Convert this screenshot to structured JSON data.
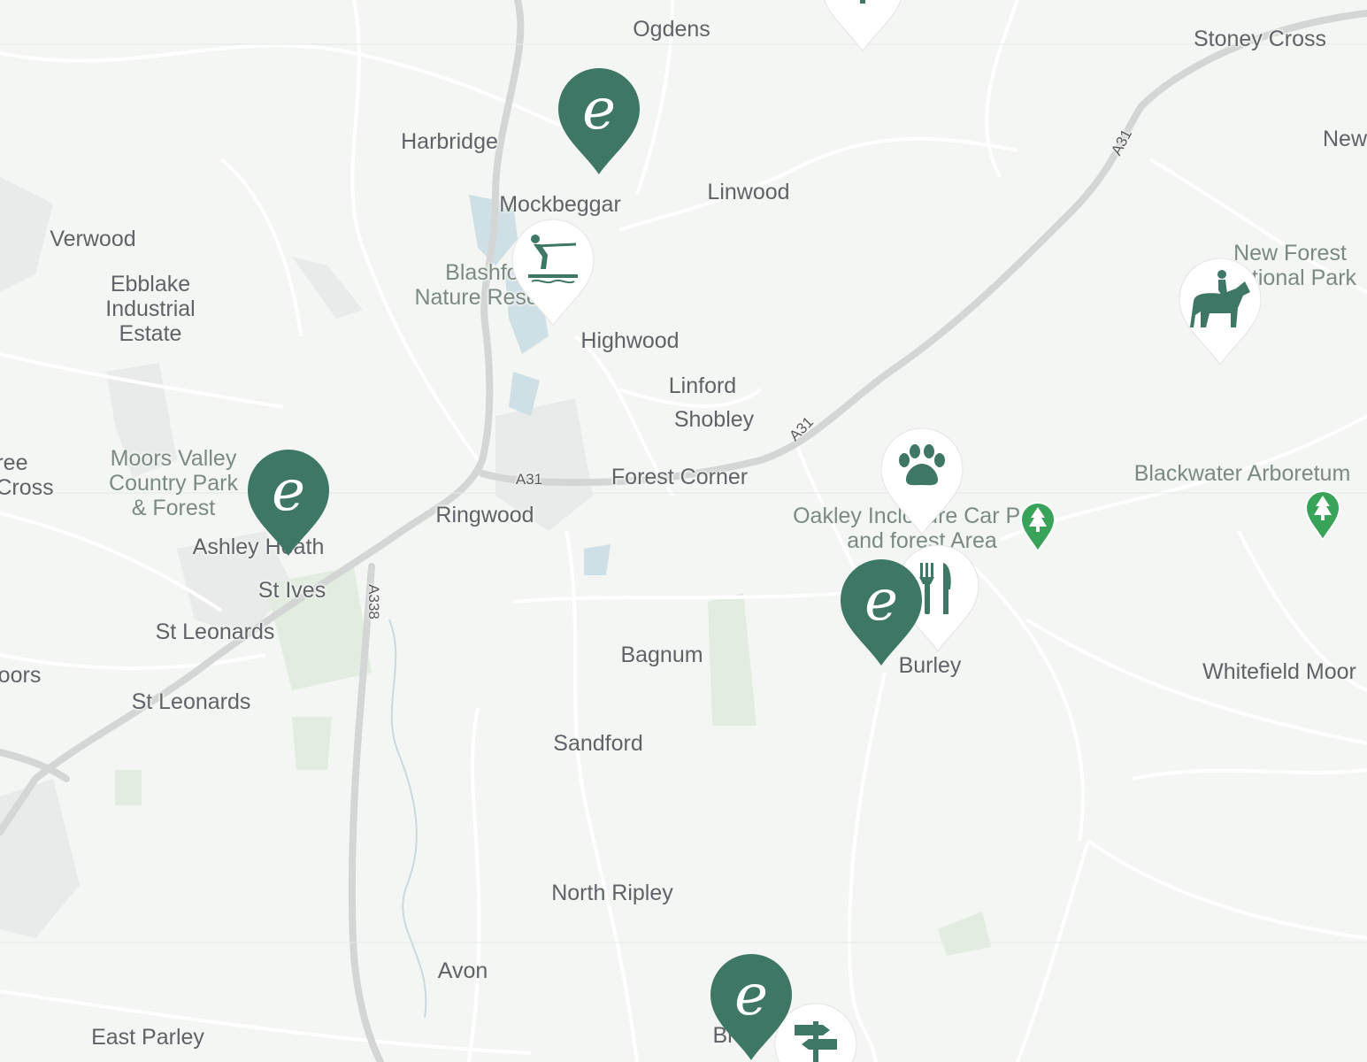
{
  "map": {
    "place_labels": {
      "ogdens": "Ogdens",
      "stoney_cross": "Stoney Cross",
      "harbridge": "Harbridge",
      "new": "New",
      "mockbeggar": "Mockbeggar",
      "linwood": "Linwood",
      "verwood": "Verwood",
      "ebblake": "Ebblake\nIndustrial\nEstate",
      "highwood": "Highwood",
      "linford": "Linford",
      "shobley": "Shobley",
      "forest_corner": "Forest Corner",
      "ringwood": "Ringwood",
      "ree_cross": "ree\nCross",
      "ashley_heath": "Ashley Heath",
      "st_ives": "St Ives",
      "st_leonards_1": "St Leonards",
      "st_leonards_2": "St Leonards",
      "oors": "oors",
      "burley": "Burley",
      "bagnum": "Bagnum",
      "sandford": "Sandford",
      "north_ripley": "North Ripley",
      "avon": "Avon",
      "east_parley": "East Parley",
      "br": "Br",
      "whitefield_moor": "Whitefield Moor"
    },
    "park_labels": {
      "blashford": "Blashford\nNature Reserve",
      "moors_valley": "Moors Valley\nCountry Park\n& Forest",
      "new_forest_np": "New Forest\nNational Park",
      "oakley": "Oakley Inclosure Car Park\nand forest Area",
      "blackwater": "Blackwater Arboretum"
    },
    "road_labels": {
      "a31_ne": "A31",
      "a31_mid": "A31",
      "a31_west": "A31",
      "a338": "A338"
    },
    "markers": [
      {
        "name": "experience-marker-1",
        "icon": "e-logo-icon",
        "letter": "e",
        "type": "experience"
      },
      {
        "name": "experience-marker-2",
        "icon": "e-logo-icon",
        "letter": "e",
        "type": "experience"
      },
      {
        "name": "experience-marker-3",
        "icon": "e-logo-icon",
        "letter": "e",
        "type": "experience"
      },
      {
        "name": "experience-marker-4",
        "icon": "e-logo-icon",
        "letter": "e",
        "type": "experience"
      },
      {
        "name": "waterski-marker",
        "icon": "waterski-icon",
        "type": "activity"
      },
      {
        "name": "horse-riding-marker",
        "icon": "horse-rider-icon",
        "type": "activity"
      },
      {
        "name": "pet-friendly-marker",
        "icon": "paw-icon",
        "type": "activity"
      },
      {
        "name": "restaurant-marker",
        "icon": "fork-knife-icon",
        "type": "activity"
      },
      {
        "name": "signpost-marker-top",
        "icon": "signpost-icon",
        "type": "activity"
      },
      {
        "name": "signpost-marker-bottom",
        "icon": "signpost-icon",
        "type": "activity"
      },
      {
        "name": "park-marker-oakley",
        "icon": "tree-icon",
        "type": "park"
      },
      {
        "name": "park-marker-blackwater",
        "icon": "tree-icon",
        "type": "park"
      }
    ],
    "colors": {
      "background": "#f3f6f2",
      "marker_green": "#3e7766",
      "park_marker_green": "#3aa35a",
      "road_gray": "#d4d6d6",
      "label_gray": "#5f6368"
    }
  }
}
